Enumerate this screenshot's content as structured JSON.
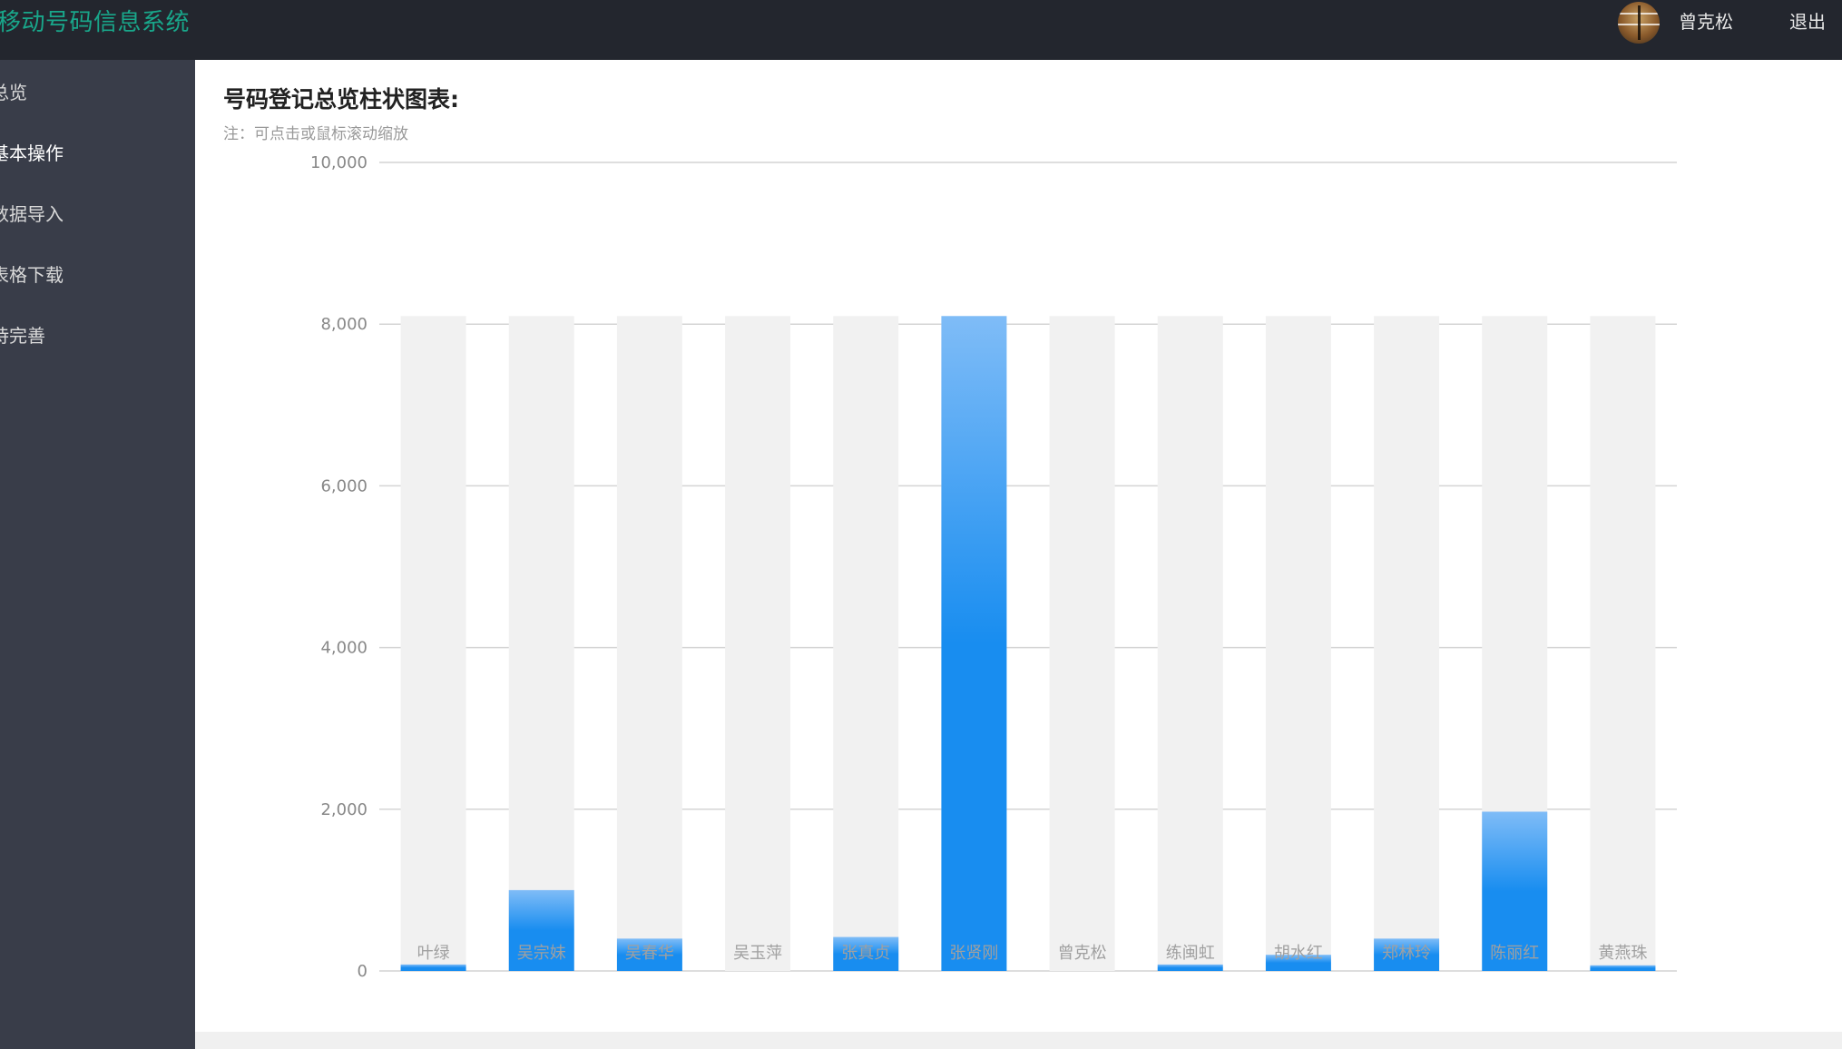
{
  "header": {
    "app_title": "移动号码信息系统",
    "user_name": "曾克松",
    "logout_label": "退出"
  },
  "sidebar": {
    "items": [
      {
        "label": "总览"
      },
      {
        "label": "基本操作"
      },
      {
        "label": "数据导入"
      },
      {
        "label": "表格下载"
      },
      {
        "label": "待完善"
      }
    ]
  },
  "chart": {
    "heading": "号码登记总览柱状图表:",
    "note": "注：可点击或鼠标滚动缩放"
  },
  "colors": {
    "bar_top": "#7fbcf7",
    "bar_bottom": "#188df0",
    "bar_background": "#f1f1f1",
    "brand": "#19a68a"
  },
  "chart_data": {
    "type": "bar",
    "categories": [
      "叶绿",
      "吴宗妹",
      "吴春华",
      "吴玉萍",
      "张真贞",
      "张贤刚",
      "曾克松",
      "练闽虹",
      "胡水红",
      "郑林玲",
      "陈丽红",
      "黄燕珠"
    ],
    "values": [
      80,
      1000,
      400,
      0,
      420,
      8100,
      0,
      80,
      200,
      400,
      1970,
      70
    ],
    "y_ticks": [
      "0",
      "2,000",
      "4,000",
      "6,000",
      "8,000",
      "10,000"
    ],
    "ylim": [
      0,
      10000
    ],
    "background_bar_value": 8100,
    "grid": true,
    "title": "",
    "xlabel": "",
    "ylabel": ""
  }
}
